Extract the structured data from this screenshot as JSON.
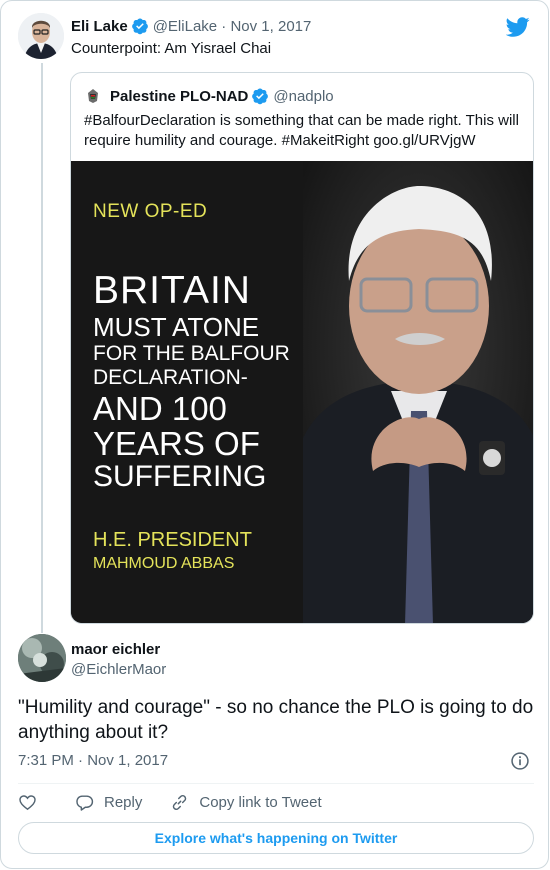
{
  "tweet": {
    "author_name": "Eli Lake",
    "handle_date": "@EliLake · Nov 1, 2017",
    "text": "Counterpoint: Am Yisrael Chai"
  },
  "quoted": {
    "author_name": "Palestine PLO-NAD",
    "handle": "@nadplo",
    "text": "#BalfourDeclaration is something that can be made right. This will require humility and courage. #MakeitRight goo.gl/URVjgW",
    "image": {
      "label": "NEW OP-ED",
      "lines": [
        "BRITAIN",
        "MUST ATONE",
        "FOR THE BALFOUR",
        "DECLARATION-",
        "AND 100",
        "YEARS OF",
        "SUFFERING"
      ],
      "byline_1": "H.E. PRESIDENT",
      "byline_2": "MAHMOUD ABBAS"
    }
  },
  "reply": {
    "author_name": "maor eichler",
    "handle": "@EichlerMaor",
    "text": "\"Humility and courage\" - so no chance the PLO is going to do anything about it?",
    "timestamp": "7:31 PM · Nov 1, 2017"
  },
  "actions": {
    "reply": "Reply",
    "copy_link": "Copy link to Tweet",
    "explore": "Explore what's happening on Twitter"
  },
  "colors": {
    "twitter_blue": "#1d9bf0",
    "muted_text": "#536471",
    "image_accent": "#e4e35a"
  },
  "icons": [
    "twitter-bird-icon",
    "verified-badge-icon",
    "info-icon",
    "heart-icon",
    "reply-icon",
    "link-icon"
  ]
}
